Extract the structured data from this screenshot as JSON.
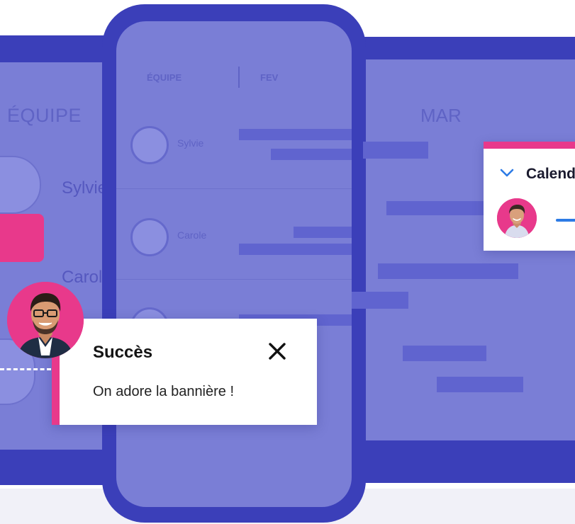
{
  "left_panel": {
    "team_header": "ÉQUIPE",
    "members": [
      "Sylvie",
      "Carole"
    ]
  },
  "phone": {
    "col_team": "ÉQUIPE",
    "col_month": "FEV",
    "members": [
      "Sylvie",
      "Carole"
    ]
  },
  "right_panel": {
    "month_header": "MAR"
  },
  "calendar_card": {
    "title": "Calend"
  },
  "toast": {
    "title": "Succès",
    "message": "On adore la bannière !",
    "close_icon": "close-icon"
  },
  "colors": {
    "frame": "#3b3fb9",
    "screen": "#7a7ed6",
    "accent_pink": "#e8398b",
    "accent_blue": "#2d7be5"
  }
}
